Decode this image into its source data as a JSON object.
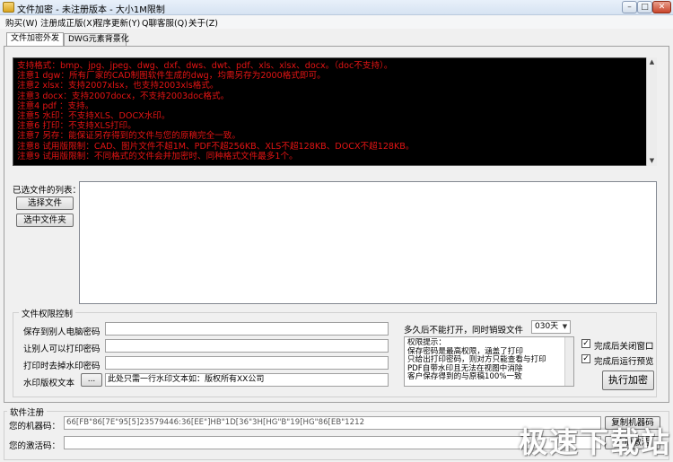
{
  "window": {
    "title": "文件加密 - 未注册版本 - 大小1M限制",
    "buttons": {
      "minimize": "–",
      "maximize": "□",
      "close": "✕"
    }
  },
  "menu": [
    "购买(W)",
    "注册成正版(X)",
    "程序更新(Y)",
    "Q聊客服(Q)",
    "关于(Z)"
  ],
  "tabs": [
    "文件加密外发",
    "DWG元素背景化"
  ],
  "notes": [
    "支持格式：bmp、jpg、jpeg、dwg、dxf、dws、dwt、pdf、xls、xlsx、docx。（doc不支持）。",
    "注意1 dgw：所有厂家的CAD制图软件生成的dwg，均需另存为2000格式即可。",
    "注意2 xlsx：支持2007xlsx，也支持2003xls格式。",
    "注意3 docx：支持2007docx，不支持2003doc格式。",
    "注意4 pdf ：支持。",
    "注意5 水印：不支持XLS、DOCX水印。",
    "注意6 打印：不支持XLS打印。",
    "注意7 另存：能保证另存得到的文件与您的原稿完全一致。",
    "注意8 试用版限制：CAD、图片文件不超1M、PDF不超256KB、XLS不超128KB、DOCX不超128KB。",
    "注意9 试用版限制：不同格式的文件会并加密时、同种格式文件最多1个。"
  ],
  "files": {
    "list_label": "已选文件的列表：",
    "select_file": "选择文件",
    "select_folder": "选中文件夹"
  },
  "permissions": {
    "legend": "文件权限控制",
    "save_pwd_label": "保存到别人电脑密码",
    "print_pwd_label": "让别人可以打印密码",
    "watermark_pwd_label": "打印时去掉水印密码",
    "watermark_text_label": "水印版权文本",
    "dots": "...",
    "watermark_text": "此处只需一行水印文本如：版权所有XX公司",
    "destroy_label": "多久后不能打开，同时销毁文件",
    "days": "030天",
    "tips": [
      "权限提示：",
      "保存密码是最高权限，涵盖了打印",
      "只给出打印密码，则对方只能查看与打印",
      "PDF自带水印且无法在视图中消除",
      "客户保存得到的与原稿100%一致"
    ],
    "close_after": "完成后关闭窗口",
    "preview_after": "完成后运行预览",
    "encrypt": "执行加密"
  },
  "registration": {
    "legend": "软件注册",
    "machine_label": "您的机器码：",
    "machine_code": "66[FB\"86[7E\"95[5]23579446:36[EE\"]HB\"1D[36\"3H[HG\"B\"19[HG\"86[EB\"1212",
    "copy_button": "复制机器码",
    "activation_label": "您的激活码：",
    "activation_code": "",
    "register_button": "注册激活"
  },
  "logo_text": "极速下载站",
  "colors": {
    "notes_text": "#e31414",
    "notes_bg": "#000000"
  }
}
